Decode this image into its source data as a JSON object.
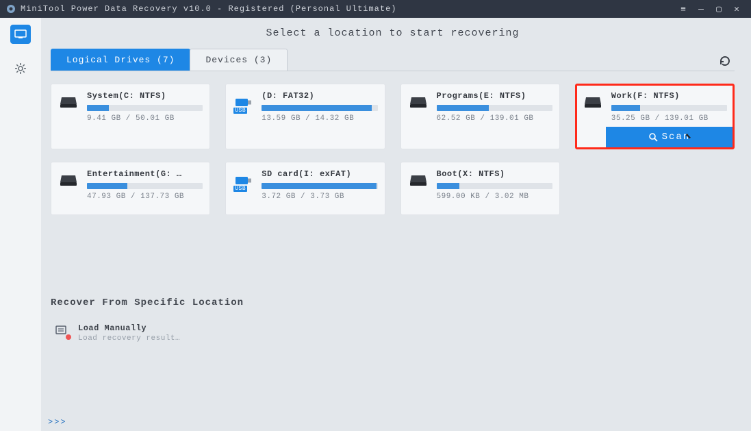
{
  "window": {
    "title": "MiniTool Power Data Recovery v10.0 - Registered (Personal Ultimate)"
  },
  "heading": "Select a location to start recovering",
  "tabs": {
    "logical": "Logical Drives (7)",
    "devices": "Devices (3)"
  },
  "drives": [
    {
      "name": "System(C: NTFS)",
      "used": "9.41 GB",
      "total": "50.01 GB",
      "pct": 19,
      "type": "hdd"
    },
    {
      "name": "(D: FAT32)",
      "used": "13.59 GB",
      "total": "14.32 GB",
      "pct": 95,
      "type": "usb"
    },
    {
      "name": "Programs(E: NTFS)",
      "used": "62.52 GB",
      "total": "139.01 GB",
      "pct": 45,
      "type": "hdd"
    },
    {
      "name": "Work(F: NTFS)",
      "used": "35.25 GB",
      "total": "139.01 GB",
      "pct": 25,
      "type": "hdd",
      "selected": true
    },
    {
      "name": "Entertainment(G: …",
      "used": "47.93 GB",
      "total": "137.73 GB",
      "pct": 35,
      "type": "hdd"
    },
    {
      "name": "SD card(I: exFAT)",
      "used": "3.72 GB",
      "total": "3.73 GB",
      "pct": 99,
      "type": "usb"
    },
    {
      "name": "Boot(X: NTFS)",
      "used": "599.00 KB",
      "total": "3.02 MB",
      "pct": 20,
      "type": "hdd"
    }
  ],
  "scan_label": "Scan",
  "section": "Recover From Specific Location",
  "load": {
    "title": "Load Manually",
    "sub": "Load recovery result…"
  },
  "expander": ">>>",
  "usb_badge": "USB"
}
